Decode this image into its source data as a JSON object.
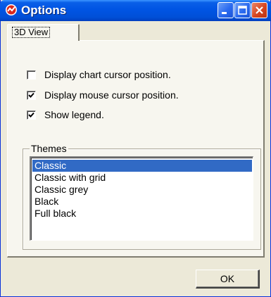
{
  "window": {
    "title": "Options",
    "app_icon": "chart-app-icon",
    "controls": [
      "minimize-icon",
      "maximize-icon",
      "close-icon"
    ]
  },
  "tabs": [
    {
      "label": "3D View",
      "active": true
    }
  ],
  "options": [
    {
      "label": "Display chart cursor position.",
      "checked": false
    },
    {
      "label": "Display mouse cursor position.",
      "checked": true
    },
    {
      "label": "Show legend.",
      "checked": true
    }
  ],
  "themes": {
    "title": "Themes",
    "items": [
      "Classic",
      "Classic with grid",
      "Classic grey",
      "Black",
      "Full black"
    ],
    "selected": "Classic"
  },
  "buttons": {
    "ok_label": "OK"
  },
  "colors": {
    "titlebar": "#0054e3",
    "selection": "#316ac5",
    "close_button": "#d6451f",
    "face": "#ece9d8"
  }
}
